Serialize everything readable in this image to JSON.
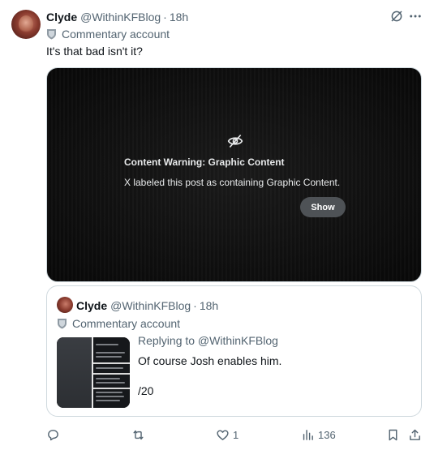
{
  "post": {
    "author_name": "Clyde",
    "author_handle": "@WithinKFBlog",
    "separator": "·",
    "time": "18h",
    "badge_label": "Commentary account",
    "text": "It's that bad isn't it?"
  },
  "media": {
    "warning_title": "Content Warning: Graphic Content",
    "warning_desc": "X labeled this post as containing Graphic Content.",
    "show_label": "Show"
  },
  "quote": {
    "author_name": "Clyde",
    "author_handle": "@WithinKFBlog",
    "separator": "·",
    "time": "18h",
    "badge_label": "Commentary account",
    "reply_to": "Replying to @WithinKFBlog",
    "text_line1": "Of course Josh enables him.",
    "text_line2": "/20"
  },
  "actions": {
    "reply_count": "",
    "repost_count": "",
    "like_count": "1",
    "views_count": "136"
  },
  "icons": [
    "grok-icon",
    "more-icon",
    "badge-shield-icon",
    "content-warning-icon",
    "reply-icon",
    "repost-icon",
    "like-icon",
    "views-icon",
    "bookmark-icon",
    "share-icon"
  ],
  "colors": {
    "text_primary": "#0f1419",
    "text_secondary": "#536471",
    "border": "#cfd9de",
    "media_bg": "#101010",
    "show_button_bg": "#4e5256"
  }
}
